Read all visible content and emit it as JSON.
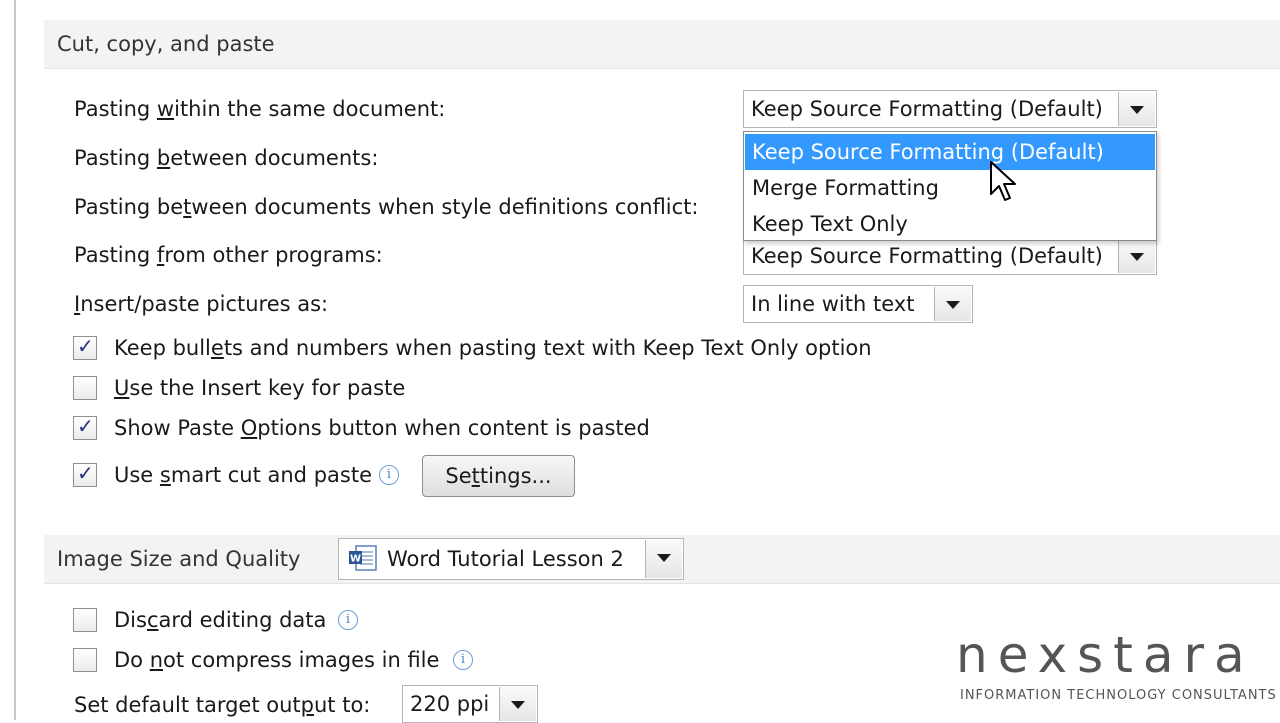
{
  "sections": {
    "cut_copy_paste_title": "Cut, copy, and paste",
    "image_size_title": "Image Size and Quality"
  },
  "paste_options": {
    "within_label_pre": "Pasting ",
    "within_label_u": "w",
    "within_label_post": "ithin the same document:",
    "within_value": "Keep Source Formatting (Default)",
    "between_label_pre": "Pasting ",
    "between_label_u": "b",
    "between_label_post": "etween documents:",
    "conflict_label_pre": "Pasting be",
    "conflict_label_u": "t",
    "conflict_label_post": "ween documents when style definitions conflict:",
    "other_label_pre": "Pasting ",
    "other_label_u": "f",
    "other_label_post": "rom other programs:",
    "other_value": "Keep Source Formatting (Default)",
    "pictures_label_pre": "",
    "pictures_label_u": "I",
    "pictures_label_post": "nsert/paste pictures as:",
    "pictures_value": "In line with text"
  },
  "dropdown": {
    "options": [
      "Keep Source Formatting (Default)",
      "Merge Formatting",
      "Keep Text Only"
    ]
  },
  "checkboxes": {
    "keep_bullets": {
      "pre": "Keep bull",
      "u": "e",
      "post": "ts and numbers when pasting text with Keep Text Only option",
      "checked": true
    },
    "insert_key": {
      "pre": "",
      "u": "U",
      "post": "se the Insert key for paste",
      "checked": false
    },
    "show_paste": {
      "pre": "Show Paste ",
      "u": "O",
      "post": "ptions button when content is pasted",
      "checked": true
    },
    "smart_cut": {
      "pre": "Use ",
      "u": "s",
      "post": "mart cut and paste",
      "checked": true
    },
    "discard": {
      "pre": "Dis",
      "u": "c",
      "post": "ard editing data",
      "checked": false
    },
    "no_compress": {
      "pre": "Do ",
      "u": "n",
      "post": "ot compress images in file",
      "checked": false
    }
  },
  "settings_button": {
    "pre": "Se",
    "u": "t",
    "post": "tings..."
  },
  "image_quality": {
    "document_value": "Word Tutorial Lesson 2",
    "output_label_pre": "Set default target out",
    "output_label_u": "p",
    "output_label_post": "ut to:",
    "output_value": "220 ppi"
  },
  "logo": {
    "wordmark": "nexstara",
    "tagline": "INFORMATION TECHNOLOGY CONSULTANTS"
  },
  "colors": {
    "selection": "#3399ff",
    "section_header_bg": "#f3f3f3",
    "checkmark": "#22337a"
  }
}
